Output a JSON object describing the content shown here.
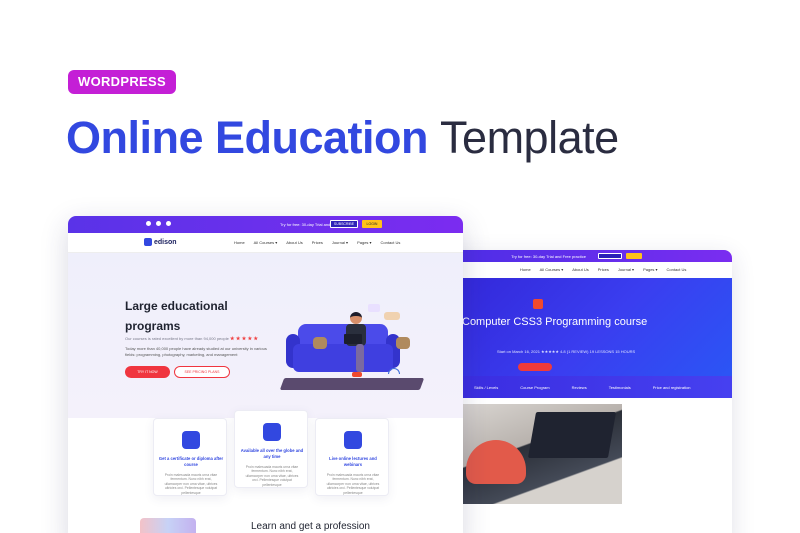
{
  "badge": "WORDPRESS",
  "headline": {
    "part1": "Online Education",
    "part2": "Template"
  },
  "mock_left": {
    "topbar": {
      "trial": "Try for free: 30-day Trial and Free practice",
      "subscribe": "SUBSCRIBE",
      "login": "LOGIN"
    },
    "logo": "edison",
    "nav": [
      "Home",
      "All Courses ▾",
      "About Us",
      "Prices",
      "Journal ▾",
      "Pages ▾",
      "Contact Us"
    ],
    "hero": {
      "title": "Large educational programs",
      "rating_text": "Our courses is rated excellent by more than 94,000 people",
      "stars": "★ ★ ★ ★ ★",
      "description": "Today more than 40,000 people have already studied at our university in various fields: programming, photography, marketing, and management",
      "btn_primary": "TRY IT NOW",
      "btn_secondary": "SEE PRICING PLANS"
    },
    "cards": [
      {
        "title": "Get a certificate or diploma after course",
        "text": "Proin malesuada mauris urna vitae fermentum. Nunc nibh erat, ullamcorper non urna vitae, ultrices ultricies orci. Pellentesque volutpat pellentesque"
      },
      {
        "title": "Available all over the globe and any time",
        "text": "Proin malesuada mauris urna vitae fermentum. Nunc nibh erat, ullamcorper non urna vitae, ultrices orci. Pellentesque volutpat pellentesque"
      },
      {
        "title": "Live online lectures and webinars",
        "text": "Proin malesuada mauris urna vitae fermentum. Nunc nibh erat, ullamcorper non urna vitae, ultrices ultricies orci. Pellentesque volutpat pellentesque"
      }
    ],
    "section_title": "Learn and get a profession"
  },
  "mock_right": {
    "topbar": {
      "trial": "Try for free: 30-day Trial and Free practice",
      "subscribe": "SUBSCRIBE",
      "login": "LOGIN"
    },
    "nav": [
      "Home",
      "All Courses ▾",
      "About Us",
      "Prices",
      "Journal ▾",
      "Pages ▾",
      "Contact Us"
    ],
    "course_title": "Computer CSS3 Programming course",
    "meta": "Start on March 16, 2021  ★★★★★  4.8 (1 REVIEW)   19 LESSONS   15 HOURS",
    "button": "SIGN UP NOW",
    "tabs": [
      "Skills / Levels",
      "Course Program",
      "Reviews",
      "Testimonials",
      "Price and registration"
    ]
  },
  "colors": {
    "brand_blue": "#3248e0",
    "badge_purple": "#c41fd6",
    "accent_red": "#f0353f",
    "yellow": "#ffc21a"
  }
}
